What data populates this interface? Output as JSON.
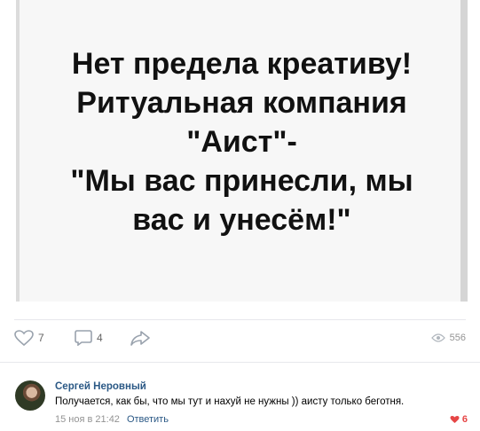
{
  "post": {
    "image_lines": [
      "Нет предела креативу!",
      "Ритуальная компания",
      "\"Аист\"-",
      "\"Мы вас принесли, мы",
      "вас и унесём!\""
    ]
  },
  "actions": {
    "likes": "7",
    "comments": "4",
    "views": "556"
  },
  "comment": {
    "author": "Сергей Неровный",
    "text": "Получается, как бы, что мы тут и нахуй не нужны )) аисту только беготня.",
    "date": "15 ноя в 21:42",
    "reply_label": "Ответить",
    "likes": "6"
  },
  "colors": {
    "link": "#2a5885",
    "muted": "#939393",
    "like_active": "#e64646"
  }
}
